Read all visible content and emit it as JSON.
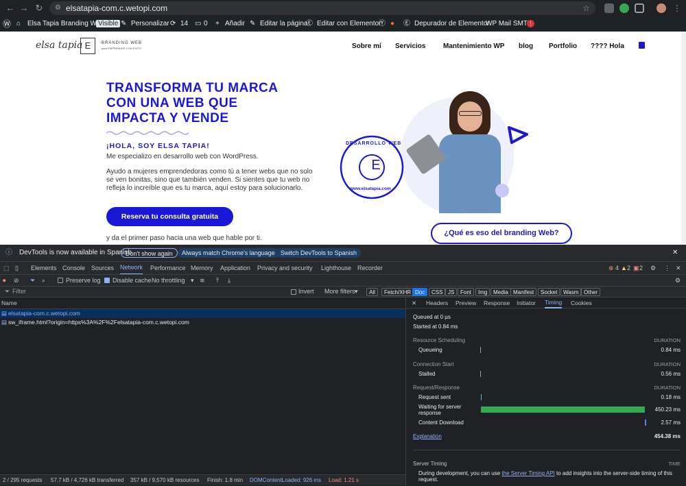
{
  "browser": {
    "url": "elsatapia-com.c.wetopi.com"
  },
  "wpbar": {
    "site_name": "Elsa Tapia Branding Web",
    "visible_badge": "Visible",
    "customize": "Personalizar",
    "updates_count": "14",
    "comments_count": "0",
    "add": "Añadir",
    "edit_page": "Editar la página",
    "edit_elementor": "Editar con Elementor",
    "debugger": "Depurador de Elementor",
    "wp_mail": "WP Mail SMTP",
    "wp_mail_badge": "!"
  },
  "site": {
    "logo_name": "elsa tapia",
    "logo_letter": "E",
    "logo_tag1": "BRANDING WEB",
    "logo_tag2": "para EMPRENDER CON ÉXITO",
    "menu": [
      "Sobre mí",
      "Servicios",
      "Mantenimiento WP",
      "blog",
      "Portfolio",
      "???? Hola"
    ],
    "headline": [
      "TRANSFORMA TU MARCA",
      "CON UNA WEB QUE",
      "IMPACTA Y VENDE"
    ],
    "greeting": "¡HOLA, SOY ELSA TAPIA!",
    "intro": "Me especializo en desarrollo web con WordPress.",
    "para_lines": [
      "Ayudo a mujeres emprendedoras como tú a tener webs que no solo",
      "se ven bonitas, sino que también venden. Si sientes que tu web no",
      "refleja lo increíble que es tu marca, aquí estoy para solucionarlo."
    ],
    "cta": "Reserva tu consulta gratuita",
    "footer_line": "y da el primer paso hacia una web que hable por ti.",
    "badge_top": "DESARROLLO WEB",
    "badge_bottom": "www.elsatapia.com",
    "badge_letter": "E",
    "cta2": "¿Qué es eso del branding Web?"
  },
  "devtools": {
    "info": "DevTools is now available in Spanish",
    "dont_show": "Don't show again",
    "match_lang": "Always match Chrome's language",
    "switch_lang": "Switch DevTools to Spanish",
    "tabs": [
      "Elements",
      "Console",
      "Sources",
      "Network",
      "Performance",
      "Memory",
      "Application",
      "Privacy and security",
      "Lighthouse",
      "Recorder"
    ],
    "errors": "4",
    "warnings": "2",
    "issues": "2",
    "preserve_log": "Preserve log",
    "disable_cache": "Disable cache",
    "throttling": "No throttling",
    "filter_placeholder": "Filter",
    "invert": "Invert",
    "more_filters": "More filters",
    "filter_chips": [
      "All",
      "Fetch/XHR",
      "Doc",
      "CSS",
      "JS",
      "Font",
      "Img",
      "Media",
      "Manifest",
      "Socket",
      "Wasm",
      "Other"
    ],
    "name_header": "Name",
    "requests": [
      "elsatapia-com.c.wetopi.com",
      "sw_iframe.html?origin=https%3A%2F%2Felsatapia-com.c.wetopi.com"
    ],
    "detail_tabs": [
      "Headers",
      "Preview",
      "Response",
      "Initiator",
      "Timing",
      "Cookies"
    ],
    "queued": "Queued at 0 µs",
    "started": "Started at 0.84 ms",
    "sections": {
      "scheduling": "Resource Scheduling",
      "connection": "Connection Start",
      "reqres": "Request/Response",
      "duration": "DURATION"
    },
    "timing": {
      "queueing": {
        "label": "Queueing",
        "value": "0.84 ms"
      },
      "stalled": {
        "label": "Stalled",
        "value": "0.56 ms"
      },
      "request_sent": {
        "label": "Request sent",
        "value": "0.18 ms"
      },
      "waiting_l1": "Waiting for server",
      "waiting_l2": "response",
      "waiting_value": "450.23 ms",
      "content_download": {
        "label": "Content Download",
        "value": "2.57 ms"
      }
    },
    "explanation": "Explanation",
    "total": "454.38 ms",
    "server_timing": "Server Timing",
    "time": "TIME",
    "st_text1": "During development, you can use ",
    "st_link": "the Server Timing API",
    "st_text2": " to add insights into the server-side timing of this",
    "st_text3": "request.",
    "status": {
      "requests": "2 / 295 requests",
      "transferred": "57.7 kB / 4,726 kB transferred",
      "resources": "357 kB / 9,570 kB resources",
      "finish": "Finish: 1.8 min",
      "dcl": "DOMContentLoaded: 926 ms",
      "load": "Load: 1.21 s"
    }
  },
  "colors": {
    "brand": "#1a18d6",
    "waiting_bar": "#34a853",
    "link": "#8ab4f8",
    "doc_chip": "#1a73e8"
  }
}
